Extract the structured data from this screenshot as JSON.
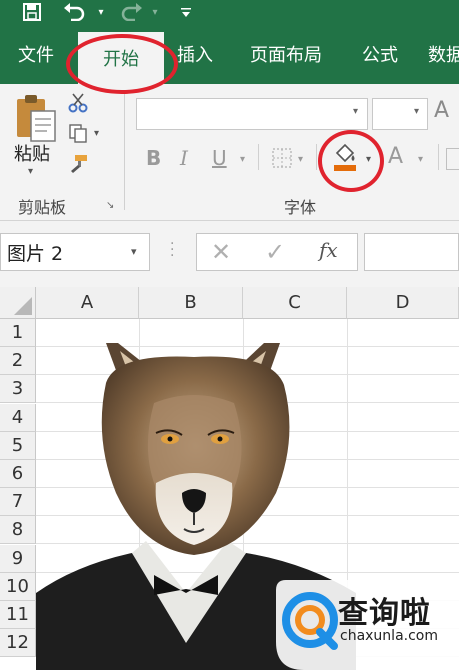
{
  "tabs": [
    {
      "label": "文件"
    },
    {
      "label": "开始"
    },
    {
      "label": "插入"
    },
    {
      "label": "页面布局"
    },
    {
      "label": "公式"
    },
    {
      "label": "数据"
    }
  ],
  "ribbon": {
    "clipboard": {
      "paste_label": "粘贴",
      "group_label": "剪贴板"
    },
    "font": {
      "group_label": "字体",
      "bold": "B",
      "italic": "I",
      "underline": "U",
      "font_color": "A",
      "grow_font": "A"
    }
  },
  "formula_bar": {
    "name_box": "图片 2",
    "fx_label": "fx"
  },
  "columns": [
    "A",
    "B",
    "C",
    "D"
  ],
  "rows": [
    "1",
    "2",
    "3",
    "4",
    "5",
    "6",
    "7",
    "8",
    "9",
    "10",
    "11",
    "12"
  ],
  "watermark": {
    "title": "查询啦",
    "url": "chaxunla.com"
  },
  "colors": {
    "excel_green": "#217346",
    "highlight_red": "#e0232e",
    "fill_orange": "#e46c0a"
  }
}
